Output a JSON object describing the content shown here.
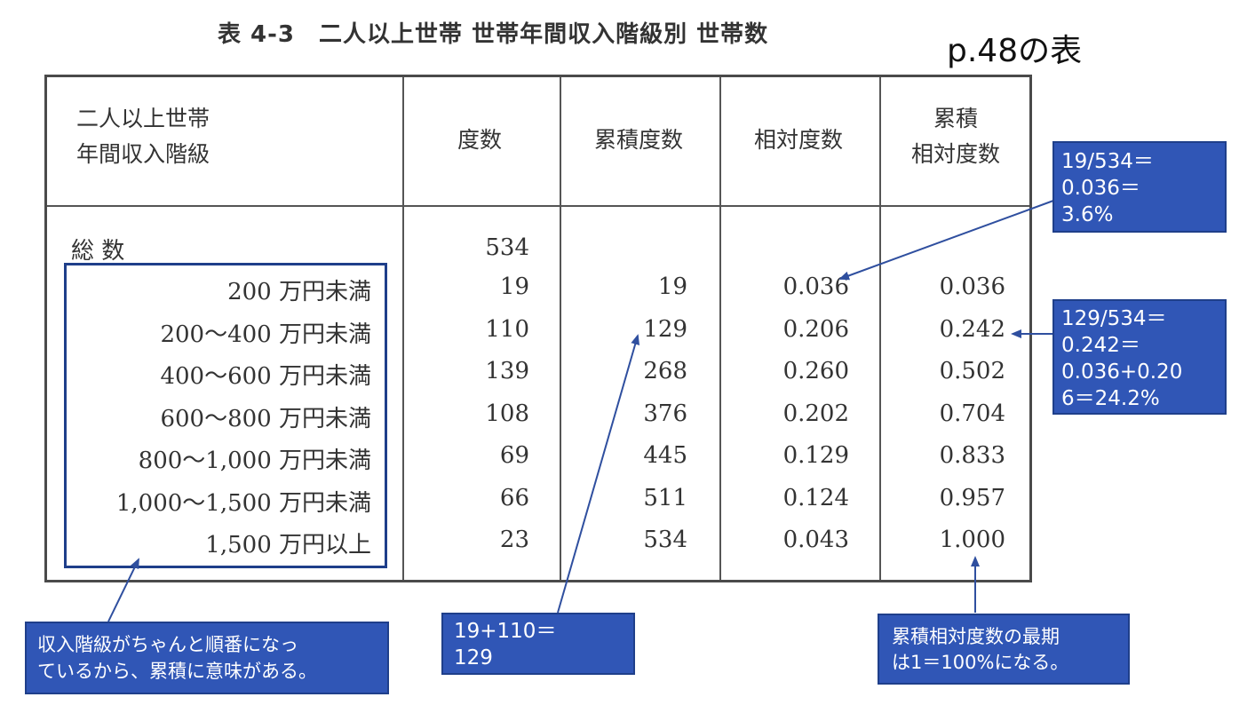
{
  "title": "表 4-3　二人以上世帯 世帯年間収入階級別 世帯数",
  "page_ref": "p.48の表",
  "table": {
    "header": {
      "class_line1": "二人以上世帯",
      "class_line2": "年間収入階級",
      "freq": "度数",
      "cum_freq": "累積度数",
      "rel_freq": "相対度数",
      "cum_rel_line1": "累積",
      "cum_rel_line2": "相対度数"
    },
    "total_label": "総 数",
    "total_value": "534",
    "rows": [
      {
        "label": "200 万円未満",
        "freq": "19",
        "cum": "19",
        "rel": "0.036",
        "cumrel": "0.036"
      },
      {
        "label": "200〜400 万円未満",
        "freq": "110",
        "cum": "129",
        "rel": "0.206",
        "cumrel": "0.242"
      },
      {
        "label": "400〜600 万円未満",
        "freq": "139",
        "cum": "268",
        "rel": "0.260",
        "cumrel": "0.502"
      },
      {
        "label": "600〜800 万円未満",
        "freq": "108",
        "cum": "376",
        "rel": "0.202",
        "cumrel": "0.704"
      },
      {
        "label": "800〜1,000 万円未満",
        "freq": "69",
        "cum": "445",
        "rel": "0.129",
        "cumrel": "0.833"
      },
      {
        "label": "1,000〜1,500 万円未満",
        "freq": "66",
        "cum": "511",
        "rel": "0.124",
        "cumrel": "0.957"
      },
      {
        "label": "1,500 万円以上",
        "freq": "23",
        "cum": "534",
        "rel": "0.043",
        "cumrel": "1.000"
      }
    ]
  },
  "callouts": {
    "rel_calc": {
      "line1": "19/534＝",
      "line2": "0.036＝",
      "line3": "3.6%"
    },
    "cumrel_calc": {
      "line1": "129/534＝",
      "line2": "0.242＝",
      "line3": "0.036+0.20",
      "line4": "6＝24.2%"
    },
    "order_note": {
      "line1": "収入階級がちゃんと順番になっ",
      "line2": "ているから、累積に意味がある。"
    },
    "cum_calc": {
      "line1": "19+110＝",
      "line2": "129"
    },
    "last_note": {
      "line1": "累積相対度数の最期",
      "line2": "は1＝100%になる。"
    }
  },
  "colors": {
    "callout_fill": "#3056b6",
    "callout_border": "#1f3f8a",
    "arrow": "#2f4f9f"
  }
}
